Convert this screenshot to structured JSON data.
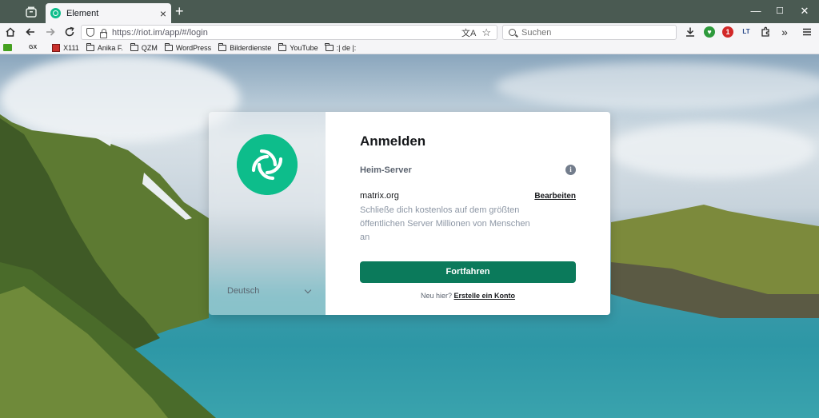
{
  "browser": {
    "tab_title": "Element",
    "tab_close": "×",
    "new_tab": "+",
    "url": "https://riot.im/app/#/login",
    "search_placeholder": "Suchen",
    "notification_count": "1",
    "ext_lt_label": "LT",
    "window": {
      "minimize": "—",
      "maximize": "☐",
      "close": "✕"
    }
  },
  "bookmarks": [
    {
      "label": "X111",
      "kind": "red"
    },
    {
      "label": "Anika F.",
      "kind": "folder"
    },
    {
      "label": "QZM",
      "kind": "folder"
    },
    {
      "label": "WordPress",
      "kind": "folder"
    },
    {
      "label": "Bilderdienste",
      "kind": "folder"
    },
    {
      "label": "YouTube",
      "kind": "folder"
    },
    {
      "label": ":| de |:",
      "kind": "folder"
    }
  ],
  "login": {
    "heading": "Anmelden",
    "homeserver_label": "Heim-Server",
    "info_icon": "i",
    "server": "matrix.org",
    "edit_link": "Bearbeiten",
    "description": "Schließe dich kostenlos auf dem größten öffentlichen Server Millionen von Menschen an",
    "continue_button": "Fortfahren",
    "new_here": "Neu hier?",
    "create_account": "Erstelle ein Konto",
    "language": "Deutsch"
  },
  "colors": {
    "accent": "#0dbd8b",
    "button": "#0b7a5b",
    "chrome": "#4a5a52"
  }
}
